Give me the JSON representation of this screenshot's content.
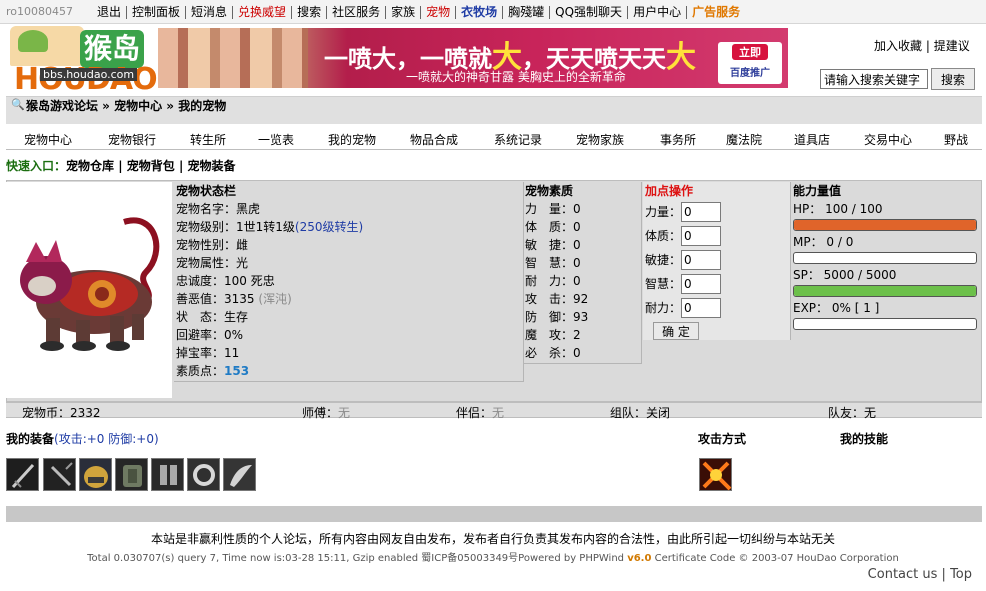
{
  "topnav": {
    "user": "ro10080457",
    "items": [
      "退出",
      "控制面板",
      "短消息",
      "兑换威望",
      "搜索",
      "社区服务",
      "家族",
      "宠物",
      "衣牧场",
      "胸殘罐",
      "QQ强制聊天",
      "用户中心",
      "广告服务"
    ]
  },
  "logo": {
    "url": "bbs.houdao.com",
    "word": "HOUDAO",
    "badge": "猴岛"
  },
  "banner": {
    "headline_a": "一喷大，一喷就",
    "headline_big": "大",
    "headline_b": "，天天喷天天",
    "headline_big2": "大",
    "sub": "一喷就大的神奇甘露 美胸史上的全新革命",
    "badge1": "立即",
    "badge2": "百度推广"
  },
  "rightlinks": {
    "fav": "加入收藏",
    "suggest": "提建议"
  },
  "search": {
    "placeholder": "请输入搜索关键字",
    "button": "搜索"
  },
  "breadcrumb": "猴岛游戏论坛 » 宠物中心 » 我的宠物",
  "petnav": [
    "宠物中心",
    "宠物银行",
    "转生所",
    "一览表",
    "我的宠物",
    "物品合成",
    "系统记录",
    "宠物家族",
    "事务所",
    "魔法院",
    "道具店",
    "交易中心",
    "野战"
  ],
  "quick": {
    "label": "快速入口：",
    "items": [
      "宠物仓库",
      "宠物背包",
      "宠物装备"
    ]
  },
  "status": {
    "title": "宠物状态栏",
    "name_l": "宠物名字：",
    "name": "黑虎",
    "level_l": "宠物级别：",
    "level": "1世1转1级",
    "level_link": "(250级转生)",
    "gender_l": "宠物性别：",
    "gender": "雌",
    "attr_l": "宠物属性：",
    "attr": "光",
    "loyal_l": "忠诚度：",
    "loyal": "100 死忠",
    "evil_l": "善恶值：",
    "evil": "3135",
    "evil_note": "(浑沌)",
    "state_l": "状　态：",
    "state": "生存",
    "dodge_l": "回避率：",
    "dodge": "0%",
    "drop_l": "掉宝率：",
    "drop": "11",
    "points_l": "素质点：",
    "points": "153"
  },
  "attrs": {
    "title": "宠物素质",
    "items": [
      {
        "l": "力　量：",
        "v": "0"
      },
      {
        "l": "体　质：",
        "v": "0"
      },
      {
        "l": "敏　捷：",
        "v": "0"
      },
      {
        "l": "智　慧：",
        "v": "0"
      },
      {
        "l": "耐　力：",
        "v": "0"
      },
      {
        "l": "攻　击：",
        "v": "92"
      },
      {
        "l": "防　御：",
        "v": "93"
      },
      {
        "l": "魔　攻：",
        "v": "2"
      },
      {
        "l": "必　杀：",
        "v": "0"
      }
    ]
  },
  "addpt": {
    "title": "加点操作",
    "fields": [
      {
        "l": "力量：",
        "v": "0"
      },
      {
        "l": "体质：",
        "v": "0"
      },
      {
        "l": "敏捷：",
        "v": "0"
      },
      {
        "l": "智慧：",
        "v": "0"
      },
      {
        "l": "耐力：",
        "v": "0"
      }
    ],
    "confirm": "确 定"
  },
  "ability": {
    "title": "能力量值",
    "hp": "HP： 100 / 100",
    "mp": "MP： 0 / 0",
    "sp": "SP： 5000 / 5000",
    "exp": "EXP： 0% [ 1 ]",
    "hp_color": "#e0642a",
    "sp_color": "#6cc04a",
    "exp_color": "#e0642a",
    "hp_fill": 1.0,
    "mp_fill": 0.0,
    "sp_fill": 1.0,
    "exp_fill": 0.0
  },
  "stats": {
    "coins_l": "宠物币：",
    "coins": "2332",
    "master_l": "师傅：",
    "master": "无",
    "partner_l": "伴侣：",
    "partner": "无",
    "team_l": "组队：",
    "team": "关闭",
    "mate_l": "队友：",
    "mate": "无"
  },
  "equip": {
    "title": "我的装备",
    "bonus": "(攻击:+0 防御:+0)",
    "attack": "攻击方式",
    "skills": "我的技能"
  },
  "disclaimer": "本站是非赢利性质的个人论坛，所有内容由网友自由发布，发布者自行负责其发布内容的合法性，由此所引起一切纠纷与本站无关",
  "footer": {
    "a": "Total 0.030707(s) query 7, Time now is:03-28 15:11, Gzip enabled 蜀ICP备05003349号Powered by PHPWind",
    "ver": "v6.0",
    "b": "Certificate Code © 2003-07 HouDao Corporation"
  },
  "foot2": {
    "contact": "Contact us",
    "top": "Top"
  }
}
